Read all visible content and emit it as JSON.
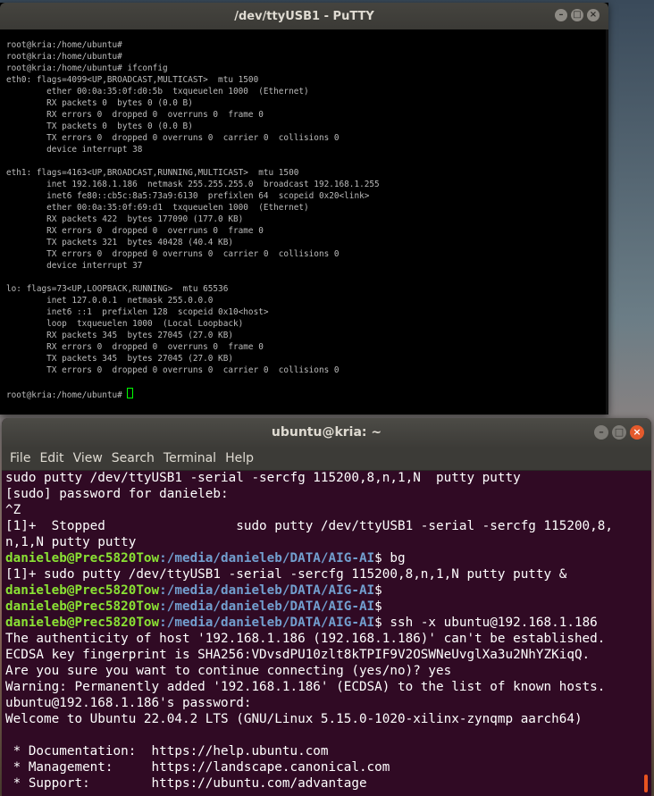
{
  "putty": {
    "title": "/dev/ttyUSB1 - PuTTY",
    "lines": [
      "root@kria:/home/ubuntu#",
      "root@kria:/home/ubuntu#",
      "root@kria:/home/ubuntu# ifconfig",
      "eth0: flags=4099<UP,BROADCAST,MULTICAST>  mtu 1500",
      "        ether 00:0a:35:0f:d0:5b  txqueuelen 1000  (Ethernet)",
      "        RX packets 0  bytes 0 (0.0 B)",
      "        RX errors 0  dropped 0  overruns 0  frame 0",
      "        TX packets 0  bytes 0 (0.0 B)",
      "        TX errors 0  dropped 0 overruns 0  carrier 0  collisions 0",
      "        device interrupt 38",
      "",
      "eth1: flags=4163<UP,BROADCAST,RUNNING,MULTICAST>  mtu 1500",
      "        inet 192.168.1.186  netmask 255.255.255.0  broadcast 192.168.1.255",
      "        inet6 fe80::cb5c:8a5:73a9:6130  prefixlen 64  scopeid 0x20<link>",
      "        ether 00:0a:35:0f:69:d1  txqueuelen 1000  (Ethernet)",
      "        RX packets 422  bytes 177090 (177.0 KB)",
      "        RX errors 0  dropped 0  overruns 0  frame 0",
      "        TX packets 321  bytes 40428 (40.4 KB)",
      "        TX errors 0  dropped 0 overruns 0  carrier 0  collisions 0",
      "        device interrupt 37",
      "",
      "lo: flags=73<UP,LOOPBACK,RUNNING>  mtu 65536",
      "        inet 127.0.0.1  netmask 255.0.0.0",
      "        inet6 ::1  prefixlen 128  scopeid 0x10<host>",
      "        loop  txqueuelen 1000  (Local Loopback)",
      "        RX packets 345  bytes 27045 (27.0 KB)",
      "        RX errors 0  dropped 0  overruns 0  frame 0",
      "        TX packets 345  bytes 27045 (27.0 KB)",
      "        TX errors 0  dropped 0 overruns 0  carrier 0  collisions 0",
      ""
    ],
    "last_prompt": "root@kria:/home/ubuntu# "
  },
  "terminal": {
    "title": "ubuntu@kria: ~",
    "menu": [
      "File",
      "Edit",
      "View",
      "Search",
      "Terminal",
      "Help"
    ],
    "user_host": "danieleb@Prec5820Tow",
    "path": ":/media/danieleb/DATA/AIG-AI",
    "lines_top": [
      "sudo putty /dev/ttyUSB1 -serial -sercfg 115200,8,n,1,N  putty putty",
      "[sudo] password for danieleb:",
      "^Z",
      "[1]+  Stopped                 sudo putty /dev/ttyUSB1 -serial -sercfg 115200,8,",
      "n,1,N putty putty"
    ],
    "cmd_bg": "$ bg",
    "bg_out": "[1]+ sudo putty /dev/ttyUSB1 -serial -sercfg 115200,8,n,1,N putty putty &",
    "cmd_empty1": "$",
    "cmd_empty2": "$",
    "cmd_ssh": "$ ssh -x ubuntu@192.168.1.186",
    "lines_bottom": [
      "The authenticity of host '192.168.1.186 (192.168.1.186)' can't be established.",
      "ECDSA key fingerprint is SHA256:VDvsdPU10zlt8kTPIF9V2OSWNeUvglXa3u2NhYZKiqQ.",
      "Are you sure you want to continue connecting (yes/no)? yes",
      "Warning: Permanently added '192.168.1.186' (ECDSA) to the list of known hosts.",
      "ubuntu@192.168.1.186's password:",
      "Welcome to Ubuntu 22.04.2 LTS (GNU/Linux 5.15.0-1020-xilinx-zynqmp aarch64)",
      "",
      " * Documentation:  https://help.ubuntu.com",
      " * Management:     https://landscape.canonical.com",
      " * Support:        https://ubuntu.com/advantage"
    ]
  }
}
